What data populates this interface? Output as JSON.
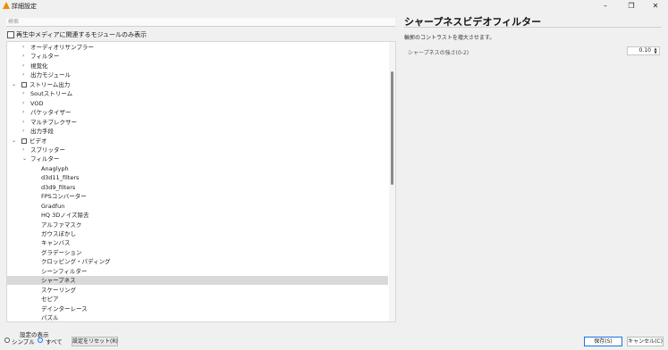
{
  "window": {
    "title": "詳細設定",
    "min": "–",
    "max": "❐",
    "close": "✕"
  },
  "search": {
    "placeholder": "検索"
  },
  "current_only": {
    "label": "再生中メディアに関連するモジュールのみ表示"
  },
  "tree": {
    "rows": [
      {
        "label": "オーディオリサンプラー",
        "level": 1,
        "caret": "›"
      },
      {
        "label": "フィルター",
        "level": 1,
        "caret": "›"
      },
      {
        "label": "視覚化",
        "level": 1,
        "caret": "›"
      },
      {
        "label": "出力モジュール",
        "level": 1,
        "caret": "›"
      },
      {
        "label": "ストリーム出力",
        "level": 0,
        "caret": "⌄",
        "icon": "stream-output-icon"
      },
      {
        "label": "Soutストリーム",
        "level": 1,
        "caret": "›"
      },
      {
        "label": "VOD",
        "level": 1,
        "caret": "›"
      },
      {
        "label": "パケッタイザー",
        "level": 1,
        "caret": "›"
      },
      {
        "label": "マルチプレクサー",
        "level": 1,
        "caret": "›"
      },
      {
        "label": "出力手段",
        "level": 1,
        "caret": "›"
      },
      {
        "label": "ビデオ",
        "level": 0,
        "caret": "⌄",
        "icon": "video-icon"
      },
      {
        "label": "スプリッター",
        "level": 1,
        "caret": "›"
      },
      {
        "label": "フィルター",
        "level": 1,
        "caret": "⌄"
      },
      {
        "label": "Anaglyph",
        "level": 2
      },
      {
        "label": "d3d11_filters",
        "level": 2
      },
      {
        "label": "d3d9_filters",
        "level": 2
      },
      {
        "label": "FPSコンバーター",
        "level": 2
      },
      {
        "label": "Gradfun",
        "level": 2
      },
      {
        "label": "HQ 3Dノイズ除去",
        "level": 2
      },
      {
        "label": "アルファマスク",
        "level": 2
      },
      {
        "label": "ガウスぼかし",
        "level": 2
      },
      {
        "label": "キャンバス",
        "level": 2
      },
      {
        "label": "グラデーション",
        "level": 2
      },
      {
        "label": "クロッピング・パディング",
        "level": 2
      },
      {
        "label": "シーンフィルター",
        "level": 2
      },
      {
        "label": "シャープネス",
        "level": 2,
        "selected": true
      },
      {
        "label": "スケーリング",
        "level": 2
      },
      {
        "label": "セピア",
        "level": 2
      },
      {
        "label": "デインターレース",
        "level": 2
      },
      {
        "label": "パズル",
        "level": 2
      }
    ]
  },
  "panel": {
    "title": "シャープネスビデオフィルター",
    "description": "輪郭のコントラストを増大させます。",
    "setting_label": "シャープネスの強さ(0-2)",
    "setting_value": "0.10",
    "spin_up": "▲",
    "spin_down": "▼"
  },
  "bottom": {
    "display_label": "設定の表示",
    "simple_label": "シンプル",
    "all_label": "すべて",
    "reset_label": "設定をリセット(R)",
    "save_label": "保存(S)",
    "cancel_label": "キャンセル(C)"
  },
  "colors": {
    "accent": "#1a73e8",
    "selected_row": "#d9d9d9",
    "app_icon": "#f08c00"
  }
}
